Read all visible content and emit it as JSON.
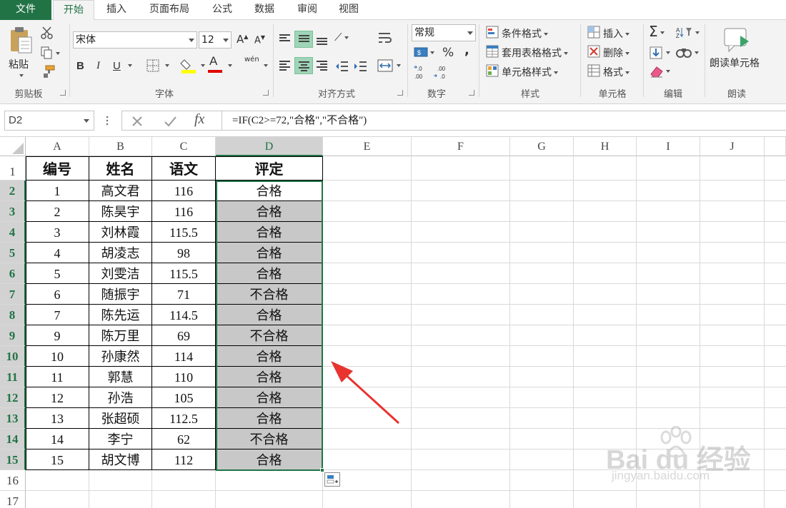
{
  "tabs": [
    "文件",
    "开始",
    "插入",
    "页面布局",
    "公式",
    "数据",
    "审阅",
    "视图"
  ],
  "active_tab": "开始",
  "ribbon": {
    "clipboard": {
      "paste_label": "粘贴",
      "group_label": "剪贴板"
    },
    "font": {
      "font_name": "宋体",
      "font_size": "12",
      "group_label": "字体",
      "bold": "B",
      "italic": "I",
      "underline": "U",
      "font_color_glyph": "A",
      "grow_glyph": "A",
      "shrink_glyph": "A",
      "phonetic_glyph": "wén"
    },
    "alignment": {
      "group_label": "对齐方式"
    },
    "number": {
      "format": "常规",
      "group_label": "数字",
      "percent": "%",
      "comma": ","
    },
    "styles": {
      "conditional": "条件格式",
      "table": "套用表格格式",
      "cell_styles": "单元格样式",
      "group_label": "样式"
    },
    "cells": {
      "insert": "插入",
      "delete": "删除",
      "format": "格式",
      "group_label": "单元格"
    },
    "editing": {
      "sum_glyph": "Σ",
      "group_label": "编辑"
    },
    "read": {
      "read_cell": "朗读单元格",
      "group_label": "朗读"
    }
  },
  "formula_bar": {
    "name_box": "D2",
    "fx": "fx",
    "formula": "=IF(C2>=72,\"合格\",\"不合格\")"
  },
  "columns": [
    "A",
    "B",
    "C",
    "D",
    "E",
    "F",
    "G",
    "H",
    "I",
    "J"
  ],
  "selected_column": "D",
  "row_numbers": [
    "1",
    "2",
    "3",
    "4",
    "5",
    "6",
    "7",
    "8",
    "9",
    "10",
    "11",
    "12",
    "13",
    "14",
    "15",
    "16",
    "17"
  ],
  "table": {
    "headers": [
      "编号",
      "姓名",
      "语文",
      "评定"
    ],
    "rows": [
      [
        "1",
        "高文君",
        "116",
        "合格"
      ],
      [
        "2",
        "陈昊宇",
        "116",
        "合格"
      ],
      [
        "3",
        "刘林霞",
        "115.5",
        "合格"
      ],
      [
        "4",
        "胡凌志",
        "98",
        "合格"
      ],
      [
        "5",
        "刘雯洁",
        "115.5",
        "合格"
      ],
      [
        "6",
        "随振宇",
        "71",
        "不合格"
      ],
      [
        "7",
        "陈先运",
        "114.5",
        "合格"
      ],
      [
        "9",
        "陈万里",
        "69",
        "不合格"
      ],
      [
        "10",
        "孙康然",
        "114",
        "合格"
      ],
      [
        "11",
        "郭慧",
        "110",
        "合格"
      ],
      [
        "12",
        "孙浩",
        "105",
        "合格"
      ],
      [
        "13",
        "张超硕",
        "112.5",
        "合格"
      ],
      [
        "14",
        "李宁",
        "62",
        "不合格"
      ],
      [
        "15",
        "胡文博",
        "112",
        "合格"
      ]
    ]
  },
  "watermark": {
    "brand": "Bai du 经验",
    "url": "jingyan.baidu.com"
  },
  "colors": {
    "accent": "#217346",
    "selection_fill": "#c8c8c8",
    "arrow": "#e8332f"
  }
}
